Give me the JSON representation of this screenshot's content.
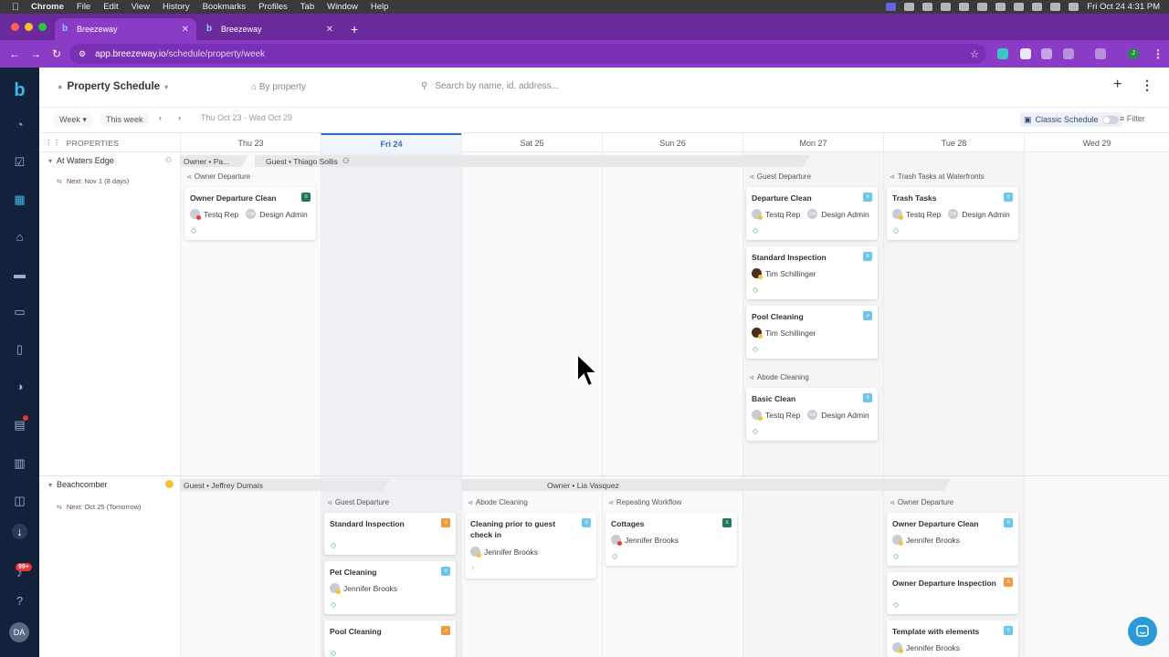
{
  "os_menu": {
    "items": [
      "Chrome",
      "File",
      "Edit",
      "View",
      "History",
      "Bookmarks",
      "Profiles",
      "Tab",
      "Window",
      "Help"
    ],
    "clock": "Fri Oct 24  4:31 PM"
  },
  "browser": {
    "tabs": [
      {
        "title": "Breezeway",
        "active": true
      },
      {
        "title": "Breezeway",
        "active": false
      }
    ],
    "url_host": "app.breezeway.io",
    "url_path": "/schedule/property/week",
    "profile_initial": "J"
  },
  "sidebar": {
    "items": [
      "logo-icon",
      "dashboard-icon",
      "tasks-icon",
      "calendar-icon",
      "home-icon",
      "bed-icon",
      "chat-icon",
      "book-icon",
      "reports-icon",
      "billing-icon",
      "receipt-icon",
      "supply-icon",
      "download-icon",
      "notifications-icon",
      "help-icon"
    ],
    "notification_count": "99+",
    "user_initials": "DA"
  },
  "header": {
    "title": "Property Schedule",
    "group_by": "By property",
    "search_placeholder": "Search by name, id, address..."
  },
  "toolbar": {
    "view": "Week",
    "this_week": "This week",
    "range": "Thu Oct 23 - Wed Oct 29",
    "classic": "Classic Schedule",
    "filter": "Filter"
  },
  "grid": {
    "properties_label": "PROPERTIES",
    "days": [
      "Thu 23",
      "Fri 24",
      "Sat 25",
      "Sun 26",
      "Mon 27",
      "Tue 28",
      "Wed 29"
    ],
    "today_index": 1
  },
  "properties": [
    {
      "name": "At Waters Edge",
      "next": "Next: Nov 1 (8 days)",
      "stays": [
        "Owner • Pa...",
        "Guest • Thiago Sollis"
      ],
      "workflows": [
        "Owner Departure",
        "Guest Departure",
        "Trash Tasks at Waterfronts",
        "Abode Cleaning"
      ],
      "tasks": [
        {
          "title": "Owner Departure Clean",
          "assignees": [
            "Testq Rep",
            "Design Admin"
          ],
          "type_color": "#1f7a52",
          "type_icon": "≡"
        },
        {
          "title": "Departure Clean",
          "assignees": [
            "Testq Rep",
            "Design Admin"
          ],
          "type_color": "#6ac6ea",
          "type_icon": "≡"
        },
        {
          "title": "Standard Inspection",
          "assignees": [
            "Tim Schillinger"
          ],
          "type_color": "#6ac6ea",
          "type_icon": "≡"
        },
        {
          "title": "Pool Cleaning",
          "assignees": [
            "Tim Schillinger"
          ],
          "type_color": "#6ac6ea",
          "type_icon": "↗"
        },
        {
          "title": "Basic Clean",
          "assignees": [
            "Testq Rep",
            "Design Admin"
          ],
          "type_color": "#6ac6ea",
          "type_icon": "≡"
        },
        {
          "title": "Trash Tasks",
          "assignees": [
            "Testq Rep",
            "Design Admin"
          ],
          "type_color": "#6ac6ea",
          "type_icon": "≡"
        }
      ]
    },
    {
      "name": "Beachcomber",
      "next": "Next: Oct 25 (Tomorrow)",
      "stays": [
        "Guest • Jeffrey Dumais",
        "Owner • Lia Vasquez"
      ],
      "workflows": [
        "Guest Departure",
        "Abode Cleaning",
        "Repeating Workflow",
        "Owner Departure"
      ],
      "tasks": [
        {
          "title": "Standard Inspection",
          "assignees": [],
          "type_color": "#f09a3e",
          "type_icon": "≡"
        },
        {
          "title": "Pet Cleaning",
          "assignees": [
            "Jennifer Brooks"
          ],
          "type_color": "#6ac6ea",
          "type_icon": "≡"
        },
        {
          "title": "Pool Cleaning",
          "assignees": [],
          "type_color": "#f09a3e",
          "type_icon": "↗"
        },
        {
          "title": "Cleaning prior to guest check in",
          "assignees": [
            "Jennifer Brooks"
          ],
          "type_color": "#6ac6ea",
          "type_icon": "≡"
        },
        {
          "title": "Cottages",
          "assignees": [
            "Jennifer Brooks"
          ],
          "type_color": "#1f7a52",
          "type_icon": "≡"
        },
        {
          "title": "Owner Departure Clean",
          "assignees": [
            "Jennifer Brooks"
          ],
          "type_color": "#6ac6ea",
          "type_icon": "≡"
        },
        {
          "title": "Owner Departure Inspection",
          "assignees": [],
          "type_color": "#f09a3e",
          "type_icon": "≡"
        },
        {
          "title": "Template with elements",
          "assignees": [
            "Jennifer Brooks"
          ],
          "type_color": "#6ac6ea",
          "type_icon": "≡"
        }
      ]
    }
  ]
}
